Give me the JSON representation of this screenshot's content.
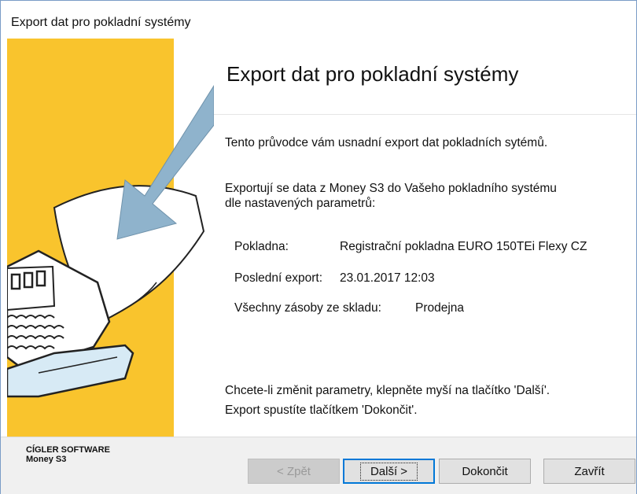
{
  "window": {
    "title": "Export dat pro pokladní systémy"
  },
  "main": {
    "heading": "Export dat pro pokladní systémy",
    "intro1": "Tento průvodce vám usnadní export dat pokladních sytémů.",
    "intro2": "Exportují se data z Money S3 do Vašeho pokladního systému dle nastavených parametrů:",
    "fields": [
      {
        "label": "Pokladna:",
        "value": "Registrační pokladna EURO 150TEi Flexy CZ"
      },
      {
        "label": "Poslední export:",
        "value": "23.01.2017 12:03"
      },
      {
        "label": "Všechny zásoby ze skladu:",
        "value": "Prodejna"
      }
    ],
    "hint1": "Chcete-li změnit parametry, klepněte myší na tlačítko 'Další'.",
    "hint2": "Export spustíte tlačítkem 'Dokončit'."
  },
  "footer": {
    "brand_line1": "CÍGLER SOFTWARE",
    "brand_line2": "Money S3"
  },
  "buttons": {
    "back": "< Zpět",
    "next": "Další >",
    "finish": "Dokončit",
    "close": "Zavřít"
  },
  "colors": {
    "accent": "#0078d7",
    "art_yellow": "#f9c42d",
    "art_arrow": "#8fb3cc"
  }
}
